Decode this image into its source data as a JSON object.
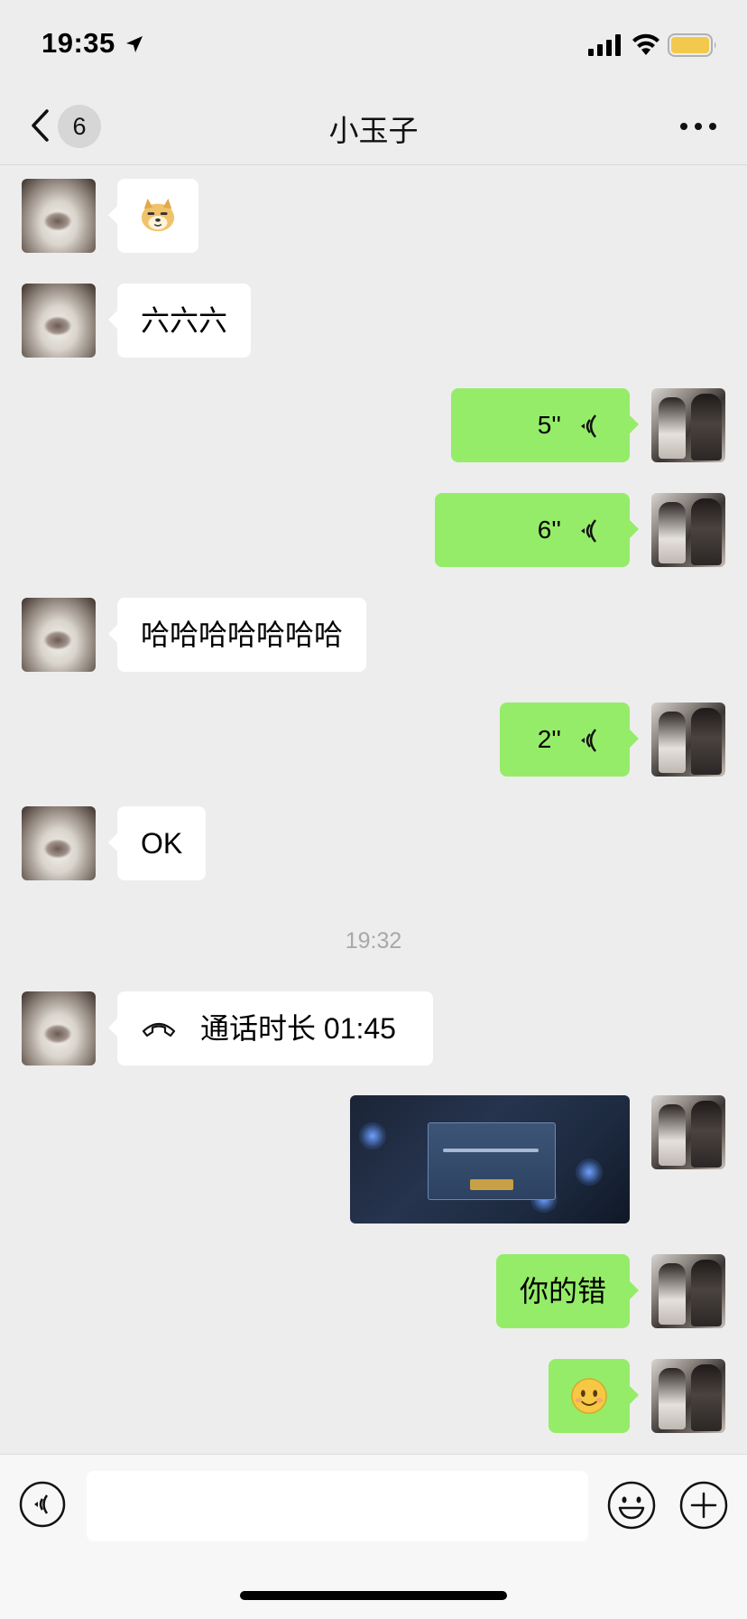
{
  "status_bar": {
    "time": "19:35",
    "icons": [
      "location-arrow-icon",
      "cellular-signal-icon",
      "wifi-icon",
      "battery-icon"
    ],
    "battery_color": "#f2c94c"
  },
  "nav": {
    "unread_count": "6",
    "title": "小玉子",
    "icons": [
      "chevron-left-icon",
      "more-icon"
    ]
  },
  "messages": [
    {
      "from": "friend",
      "type": "sticker",
      "content": "doge-emoji"
    },
    {
      "from": "friend",
      "type": "text",
      "text": "六六六"
    },
    {
      "from": "me",
      "type": "voice",
      "duration": "5''"
    },
    {
      "from": "me",
      "type": "voice",
      "duration": "6''"
    },
    {
      "from": "friend",
      "type": "text",
      "text": "哈哈哈哈哈哈哈"
    },
    {
      "from": "me",
      "type": "voice",
      "duration": "2''"
    },
    {
      "from": "friend",
      "type": "text",
      "text": "OK"
    },
    {
      "from": "system",
      "type": "timestamp",
      "text": "19:32"
    },
    {
      "from": "friend",
      "type": "call",
      "text": "通话时长 01:45"
    },
    {
      "from": "me",
      "type": "image",
      "content": "game-screenshot"
    },
    {
      "from": "me",
      "type": "text",
      "text": "你的错"
    },
    {
      "from": "me",
      "type": "sticker",
      "content": "smile-emoji"
    }
  ],
  "input_bar": {
    "placeholder": "",
    "icons": [
      "voice-input-icon",
      "emoji-icon",
      "plus-icon"
    ]
  },
  "colors": {
    "background": "#ededed",
    "outgoing_bubble": "#95ec69",
    "incoming_bubble": "#ffffff",
    "timestamp_text": "#a8a8a8"
  }
}
